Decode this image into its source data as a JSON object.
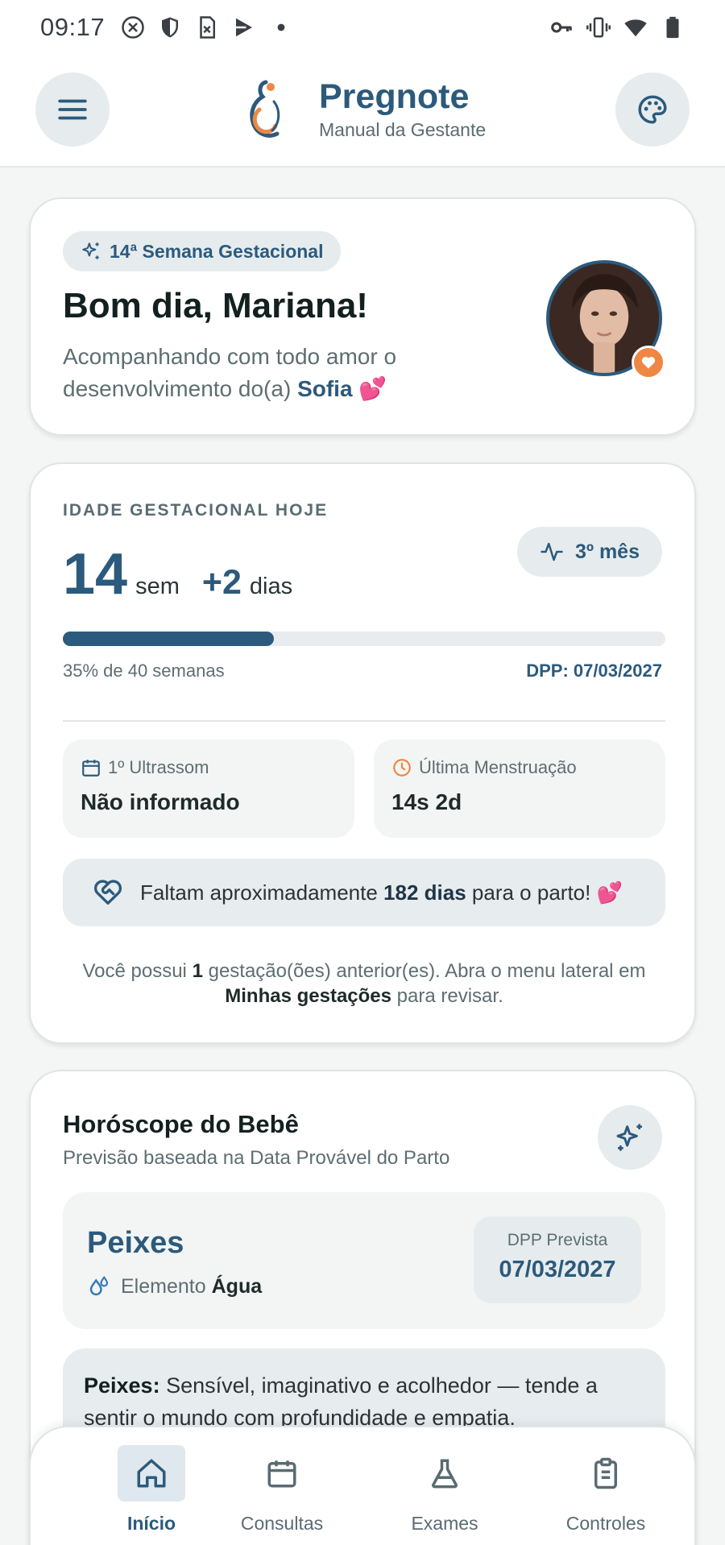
{
  "status_bar": {
    "time": "09:17",
    "left_icons": [
      "close-circle-icon",
      "shield-icon",
      "sim-icon",
      "play-store-icon",
      "dot-icon"
    ],
    "right_icons": [
      "key-icon",
      "vibrate-icon",
      "wifi-icon",
      "battery-icon"
    ]
  },
  "header": {
    "title": "Pregnote",
    "subtitle": "Manual da Gestante",
    "menu_icon": "hamburger-menu-icon",
    "palette_icon": "palette-icon"
  },
  "greeting": {
    "week_chip": "14ª Semana Gestacional",
    "title": "Bom dia, Mariana!",
    "text_prefix": "Acompanhando com todo amor o desenvolvimento do(a)",
    "baby_name": "Sofia",
    "emoji": "💕"
  },
  "gestational_age": {
    "caption": "IDADE GESTACIONAL HOJE",
    "weeks": "14",
    "weeks_unit": "sem",
    "days": "+2",
    "days_unit": "dias",
    "month_chip": "3º mês",
    "progress_fraction": 0.35,
    "progress_caption": "35% de 40 semanas",
    "dpp": "DPP: 07/03/2027",
    "ultrasound_label": "1º Ultrassom",
    "ultrasound_value": "Não informado",
    "lmp_label": "Última Menstruação",
    "lmp_value": "14s 2d",
    "countdown_prefix": "Faltam aproximadamente",
    "countdown_days": "182 dias",
    "countdown_suffix": "para o parto!",
    "countdown_emoji": "💕",
    "prev_prefix": "Você possui",
    "prev_count": "1",
    "prev_middle": "gestação(ões) anterior(es). Abra o menu lateral em",
    "prev_link": "Minhas gestações",
    "prev_suffix": "para revisar."
  },
  "horoscope": {
    "title": "Horóscope do Bebê",
    "subtitle": "Previsão baseada na Data Provável do Parto",
    "sign": "Peixes",
    "element_label": "Elemento",
    "element_value": "Água",
    "dpp_label": "DPP Prevista",
    "dpp_value": "07/03/2027",
    "desc_sign": "Peixes:",
    "desc_text": "Sensível, imaginativo e acolhedor — tende a sentir o mundo com profundidade e empatia."
  },
  "nav": {
    "items": [
      {
        "label": "Início",
        "icon": "home-icon"
      },
      {
        "label": "Consultas",
        "icon": "calendar-icon"
      },
      {
        "label": "Exames",
        "icon": "flask-icon"
      },
      {
        "label": "Controles",
        "icon": "clipboard-icon"
      }
    ]
  },
  "colors": {
    "primary": "#2c5a7c",
    "accent": "#ee8744",
    "background": "#f4f6f5"
  }
}
